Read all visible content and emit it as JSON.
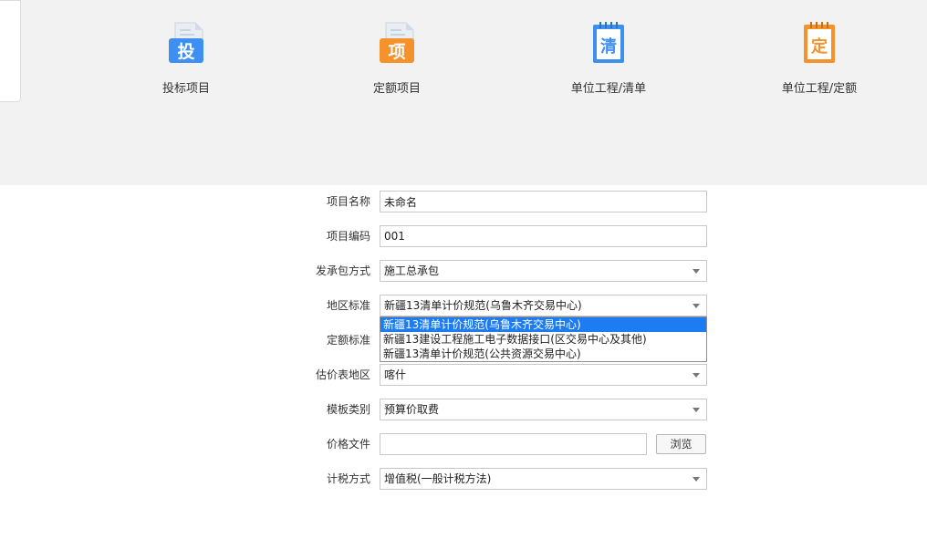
{
  "project_types": [
    {
      "label": "投标项目",
      "icon": "bid-document-icon",
      "glyph": "投",
      "color": "#3d8ff2"
    },
    {
      "label": "定额项目",
      "icon": "quota-document-icon",
      "glyph": "项",
      "color": "#f5922b"
    },
    {
      "label": "单位工程/清单",
      "icon": "bill-notebook-icon",
      "glyph": "清",
      "color": "#3d8ff2"
    },
    {
      "label": "单位工程/定额",
      "icon": "quota-notebook-icon",
      "glyph": "定",
      "color": "#f5922b"
    }
  ],
  "form": {
    "project_name": {
      "label": "项目名称",
      "value": "未命名"
    },
    "project_code": {
      "label": "项目编码",
      "value": "001"
    },
    "contract_mode": {
      "label": "发承包方式",
      "value": "施工总承包"
    },
    "region_standard": {
      "label": "地区标准",
      "value": "新疆13清单计价规范(乌鲁木齐交易中心)",
      "options": [
        "新疆13清单计价规范(乌鲁木齐交易中心)",
        "新疆13建设工程施工电子数据接口(区交易中心及其他)",
        "新疆13清单计价规范(公共资源交易中心)"
      ],
      "selected_index": 0
    },
    "quota_standard": {
      "label": "定额标准",
      "value": ""
    },
    "valuation_region": {
      "label": "估价表地区",
      "value": "喀什"
    },
    "template_category": {
      "label": "模板类别",
      "value": "预算价取费"
    },
    "price_file": {
      "label": "价格文件",
      "value": "",
      "browse_label": "浏览"
    },
    "tax_method": {
      "label": "计税方式",
      "value": "增值税(一般计税方法)"
    }
  }
}
